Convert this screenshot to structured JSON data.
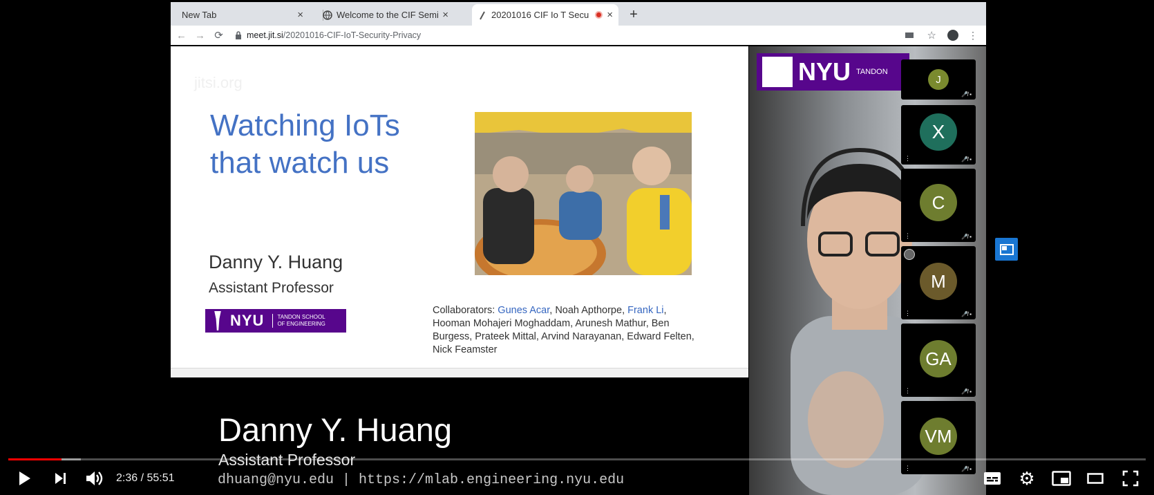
{
  "browser": {
    "tabs": [
      {
        "title": "New Tab",
        "active": false
      },
      {
        "title": "Welcome to the CIF Semin",
        "active": false
      },
      {
        "title": "20201016 CIF Io T Secu",
        "active": true
      }
    ],
    "new_tab_symbol": "+",
    "url_host": "meet.jit.si",
    "url_path": "/20201016-CIF-IoT-Security-Privacy"
  },
  "slide": {
    "watermark": "jitsi.org",
    "title": "Watching IoTs that watch us",
    "speaker_name": "Danny Y. Huang",
    "speaker_role": "Assistant Professor",
    "logo_text": "NYU",
    "logo_subtext": "TANDON SCHOOL OF ENGINEERING",
    "collaborators": {
      "label": "Collaborators:",
      "highlight_1": "Gunes Acar",
      "text_1": ", Noah Apthorpe, ",
      "highlight_2": "Frank Li",
      "text_2": ", Hooman Mohajeri Moghaddam, Arunesh Mathur, Ben Burgess, Prateek Mittal, Arvind Narayanan, Edward Felten, Nick Feamster"
    }
  },
  "camera": {
    "logo_text": "NYU",
    "logo_subtext": "TANDON"
  },
  "participants": [
    {
      "initials": "J",
      "color": "#7a8a2e"
    },
    {
      "initials": "X",
      "color": "#1f6f5c"
    },
    {
      "initials": "C",
      "color": "#6e7d2f"
    },
    {
      "initials": "M",
      "color": "#6b5a2b"
    },
    {
      "initials": "GA",
      "color": "#6e7d2f"
    },
    {
      "initials": "VM",
      "color": "#6e7d2f"
    }
  ],
  "lower_third": {
    "name": "Danny Y. Huang",
    "role": "Assistant Professor",
    "contact": "dhuang@nyu.edu | https://mlab.engineering.nyu.edu"
  },
  "player": {
    "current_time": "2:36",
    "duration": "55:51",
    "time_label": "2:36 / 55:51",
    "played_fraction": 0.047,
    "buffered_fraction": 0.064,
    "accent_color": "#ff0000"
  }
}
